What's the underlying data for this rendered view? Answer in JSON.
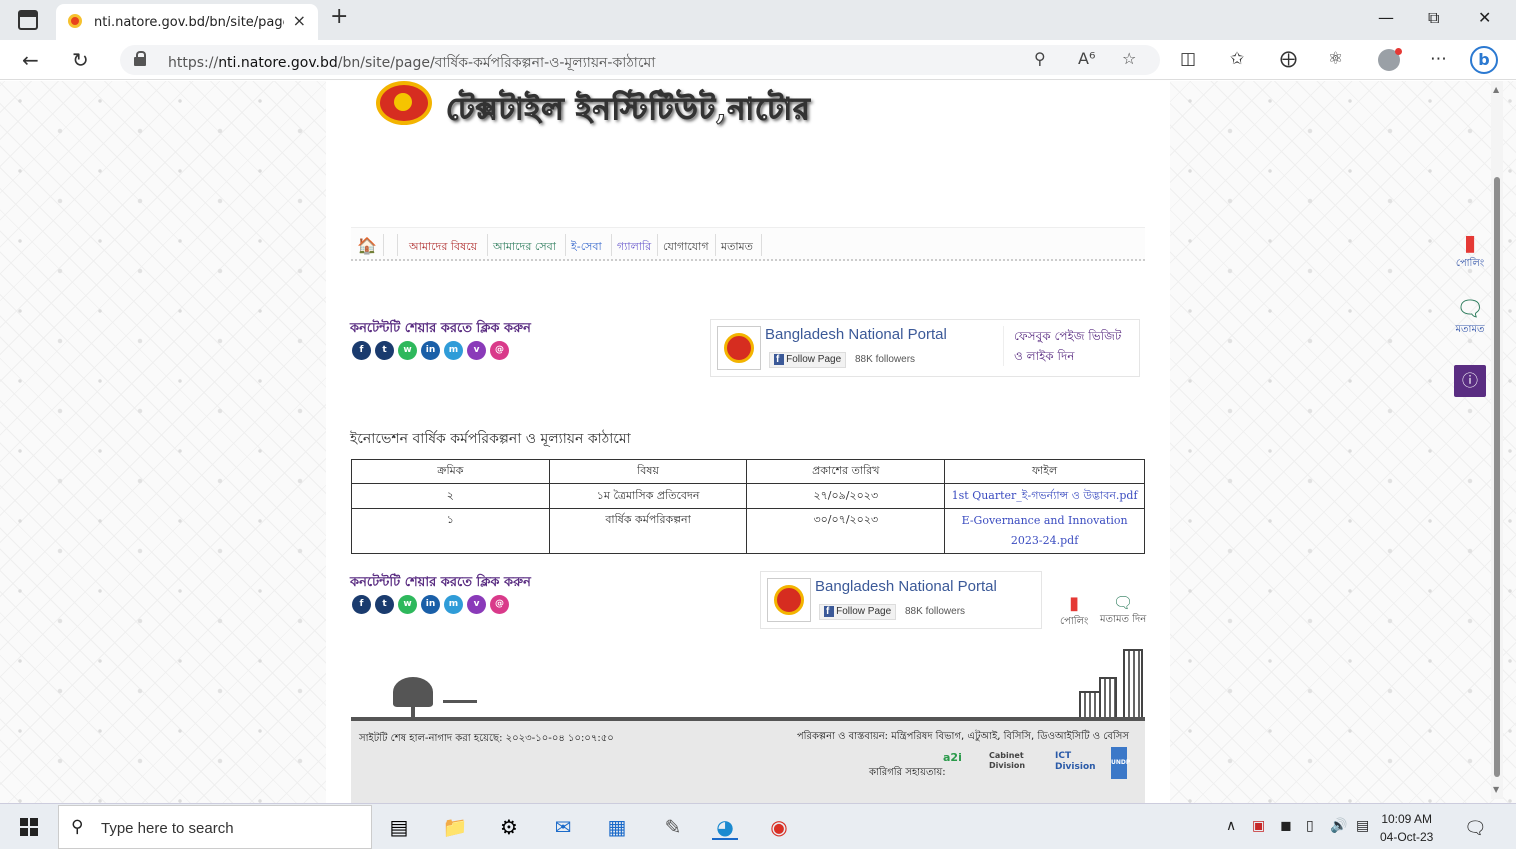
{
  "browser": {
    "tab_title": "nti.natore.gov.bd/bn/site/page/বার্ষিক",
    "tab_close": "×",
    "new_tab": "+",
    "url_prefix": "https://",
    "url_host": "nti.natore.gov.bd",
    "url_path": "/bn/site/page/বার্ষিক-কর্মপরিকল্পনা-ও-মূল্যায়ন-কাঠামো"
  },
  "site": {
    "title": "টেক্সটাইল ইনস্টিটিউট,নাটোর"
  },
  "menu": {
    "items": [
      "আমাদের বিষয়ে",
      "আমাদের সেবা",
      "ই-সেবা",
      "গ্যালারি",
      "যোগাযোগ",
      "মতামত"
    ]
  },
  "share": {
    "title": "কনটেন্টটি শেয়ার করতে ক্লিক করুন",
    "icons": [
      "facebook-icon",
      "twitter-icon",
      "whatsapp-icon",
      "linkedin-icon",
      "messenger-icon",
      "viber-icon",
      "email-icon"
    ]
  },
  "facebook": {
    "page_name": "Bangladesh National Portal",
    "follow_label": "Follow Page",
    "followers": "88K followers",
    "visit_text": "ফেসবুক পেইজ ভিজিট ও লাইক দিন"
  },
  "content": {
    "title": "ইনোভেশন বার্ষিক কর্মপরিকল্পনা ও মূল্যায়ন কাঠামো",
    "table": {
      "headers": [
        "ক্রমিক",
        "বিষয়",
        "প্রকাশের তারিখ",
        "ফাইল"
      ],
      "rows": [
        [
          "২",
          "১ম ত্রৈমাসিক প্রতিবেদন",
          "২৭/০৯/২০২৩",
          "1st Quarter_ই-গভর্ন্যান্স ও উদ্ভাবন.pdf"
        ],
        [
          "১",
          "বার্ষিক কর্মপরিকল্পনা",
          "৩০/০৭/২০২৩",
          "E-Governance and Innovation 2023-24.pdf"
        ]
      ]
    }
  },
  "widgets": {
    "poll_label": "পোলিং",
    "feedback_label": "মতামত দিন",
    "side_poll_label": "পোলিং",
    "side_feedback_label": "মতামত"
  },
  "footer": {
    "last_update": "সাইটটি শেষ হাল-নাগাদ করা হয়েছে: ২০২৩-১০-০৪ ১০:০৭:৫০",
    "credit": "পরিকল্পনা ও বাস্তবায়ন: মন্ত্রিপরিষদ বিভাগ, এটুআই, বিসিসি, ডিওআইসিটি ও বেসিস",
    "tech_partner": "কারিগরি সহায়তায়:",
    "partners": [
      "a2i",
      "Cabinet Division",
      "ICT Division",
      "UNDP"
    ]
  },
  "taskbar": {
    "search_placeholder": "Type here to search",
    "time": "10:09 AM",
    "date": "04-Oct-23"
  }
}
